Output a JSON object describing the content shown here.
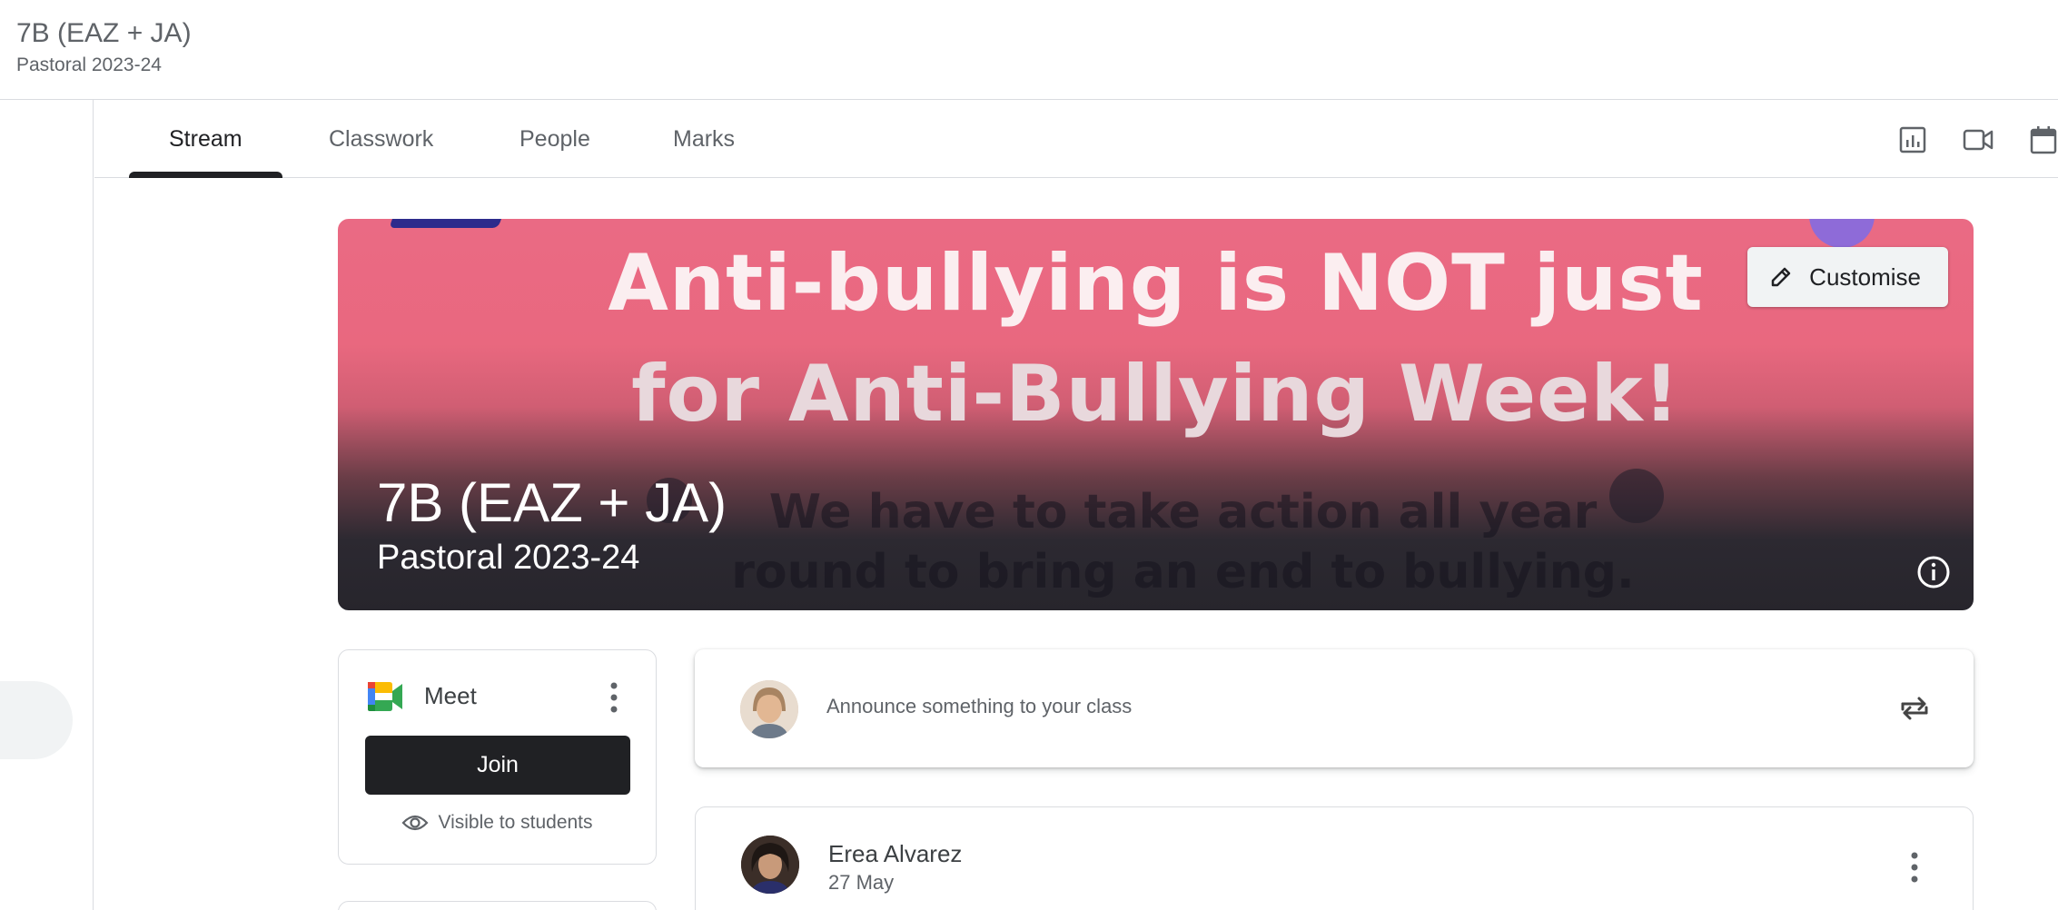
{
  "header": {
    "title": "7B (EAZ + JA)",
    "subtitle": "Pastoral 2023-24"
  },
  "tabs": [
    {
      "label": "Stream",
      "active": true
    },
    {
      "label": "Classwork",
      "active": false
    },
    {
      "label": "People",
      "active": false
    },
    {
      "label": "Marks",
      "active": false
    }
  ],
  "toolbar_icons": [
    "analytics-icon",
    "video-camera-icon",
    "calendar-icon"
  ],
  "banner": {
    "headline_line1": "Anti-bullying is NOT just",
    "headline_line2": "for Anti-Bullying Week!",
    "body_line1": "We have to take action all year",
    "body_line2": "round to bring an end to bullying.",
    "class_title": "7B (EAZ + JA)",
    "class_subtitle": "Pastoral 2023-24",
    "customise_label": "Customise"
  },
  "meet": {
    "name": "Meet",
    "join_label": "Join",
    "visibility": "Visible to students"
  },
  "announce": {
    "placeholder": "Announce something to your class"
  },
  "post": {
    "author": "Erea Alvarez",
    "date": "27 May"
  },
  "colors": {
    "banner_pink": "#ea6a84",
    "dark": "#202124",
    "border": "#dadce0"
  }
}
